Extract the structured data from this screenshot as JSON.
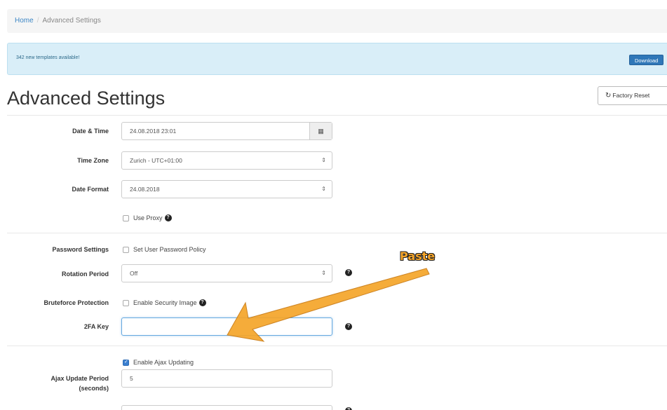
{
  "breadcrumb": {
    "home": "Home",
    "separator": "/",
    "current": "Advanced Settings"
  },
  "alert": {
    "text": "342 new templates available!",
    "button": "Download"
  },
  "page": {
    "title": "Advanced Settings",
    "reset_button": "Factory Reset",
    "reset_icon": "refresh-icon"
  },
  "fields": {
    "date_time": {
      "label": "Date & Time",
      "value": "24.08.2018 23:01",
      "icon": "calendar-icon"
    },
    "time_zone": {
      "label": "Time Zone",
      "value": "Zurich - UTC+01:00"
    },
    "date_format": {
      "label": "Date Format",
      "value": "24.08.2018"
    },
    "use_proxy": {
      "label": "Use Proxy",
      "checked": false
    },
    "password_settings": {
      "label": "Password Settings",
      "option": "Set User Password Policy",
      "checked": false
    },
    "rotation_period": {
      "label": "Rotation Period",
      "value": "Off"
    },
    "bruteforce": {
      "label": "Bruteforce Protection",
      "option": "Enable Security Image",
      "checked": false
    },
    "twofa": {
      "label": "2FA Key",
      "value": ""
    },
    "ajax_updating": {
      "option": "Enable Ajax Updating",
      "checked": true
    },
    "ajax_period": {
      "label_line1": "Ajax Update Period",
      "label_line2": "(seconds)",
      "value": "5"
    }
  },
  "annotation": {
    "text": "Paste",
    "color": "#f5a52a"
  },
  "colors": {
    "accent": "#3c86c5",
    "alert_bg": "#d9eef8",
    "button": "#2f77b8"
  }
}
